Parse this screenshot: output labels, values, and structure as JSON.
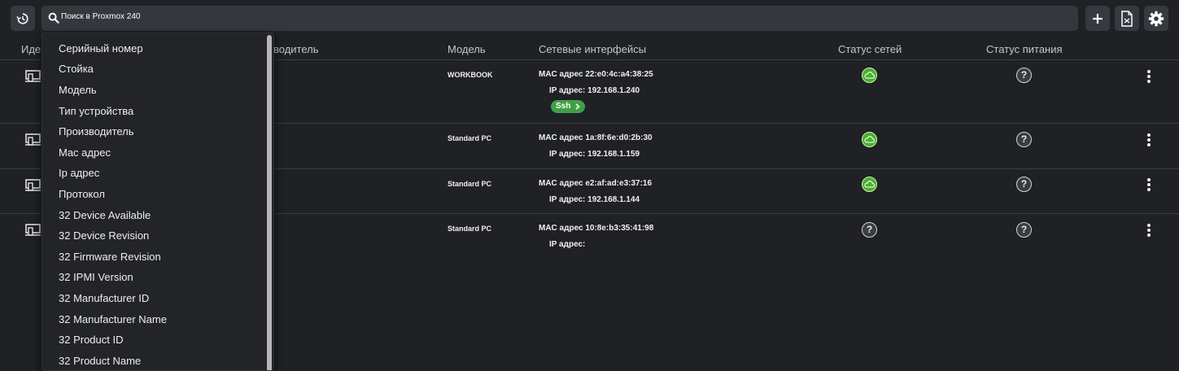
{
  "toolbar": {
    "history_icon": "history-icon",
    "search_placeholder": "Поиск в Proxmox 240",
    "add_icon": "plus-icon",
    "export_icon": "file-export-icon",
    "settings_icon": "gear-icon"
  },
  "table": {
    "headers": {
      "id": "Иде",
      "manufacturer": "водитель",
      "model": "Модель",
      "interfaces": "Сетевые интерфейсы",
      "net_status": "Статус сетей",
      "power_status": "Статус питания"
    },
    "rows": [
      {
        "model": "WORKBOOK",
        "mac": "MAC адрес 22:e0:4c:a4:38:25",
        "ip": "IP адрес: 192.168.1.240",
        "ssh": "Ssh",
        "net_status": "online",
        "power_status": "?"
      },
      {
        "model": "Standard PC",
        "mac": "MAC адрес 1a:8f:6e:d0:2b:30",
        "ip": "IP адрес: 192.168.1.159",
        "net_status": "online",
        "power_status": "?"
      },
      {
        "model": "Standard PC",
        "mac": "MAC адрес e2:af:ad:e3:37:16",
        "ip": "IP адрес: 192.168.1.144",
        "net_status": "online",
        "power_status": "?"
      },
      {
        "model": "Standard PC",
        "mac": "MAC адрес 10:8e:b3:35:41:98",
        "ip": "IP адрес:",
        "net_status": "?",
        "power_status": "?"
      }
    ]
  },
  "dropdown": {
    "items": [
      "Серийный номер",
      "Стойка",
      "Модель",
      "Тип устройства",
      "Производитель",
      "Mac адрес",
      "Ip адрес",
      "Протокол",
      "32 Device Available",
      "32 Device Revision",
      "32 Firmware Revision",
      "32 IPMI Version",
      "32 Manufacturer ID",
      "32 Manufacturer Name",
      "32 Product ID",
      "32 Product Name"
    ]
  },
  "colors": {
    "background": "#1f2125",
    "online": "#4caf2f",
    "ssh_badge": "#3fa046"
  }
}
